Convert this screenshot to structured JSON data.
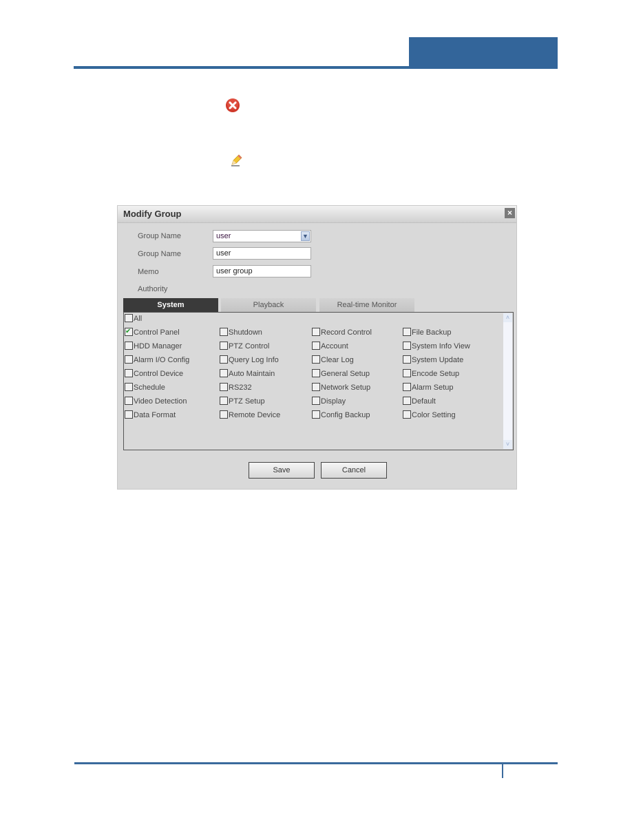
{
  "page": {
    "header_color": "#33659a",
    "icons": {
      "delete": "delete-red-x-icon",
      "edit": "pencil-edit-icon"
    }
  },
  "dialog": {
    "title": "Modify Group",
    "close_label": "×",
    "fields": {
      "group_name_select_label": "Group Name",
      "group_name_select_value": "user",
      "group_name_label": "Group Name",
      "group_name_value": "user",
      "memo_label": "Memo",
      "memo_value": "user group",
      "authority_label": "Authority"
    },
    "tabs": [
      {
        "label": "System",
        "active": true
      },
      {
        "label": "Playback",
        "active": false
      },
      {
        "label": "Real-time Monitor",
        "active": false
      }
    ],
    "all_label": "All",
    "permissions": [
      {
        "label": "Control Panel",
        "checked": true
      },
      {
        "label": "Shutdown",
        "checked": false
      },
      {
        "label": "Record Control",
        "checked": false
      },
      {
        "label": "File Backup",
        "checked": false
      },
      {
        "label": "HDD Manager",
        "checked": false
      },
      {
        "label": "PTZ Control",
        "checked": false
      },
      {
        "label": "Account",
        "checked": false
      },
      {
        "label": "System Info View",
        "checked": false
      },
      {
        "label": "Alarm I/O Config",
        "checked": false
      },
      {
        "label": "Query Log Info",
        "checked": false
      },
      {
        "label": "Clear Log",
        "checked": false
      },
      {
        "label": "System Update",
        "checked": false
      },
      {
        "label": "Control Device",
        "checked": false
      },
      {
        "label": "Auto Maintain",
        "checked": false
      },
      {
        "label": "General Setup",
        "checked": false
      },
      {
        "label": "Encode Setup",
        "checked": false
      },
      {
        "label": "Schedule",
        "checked": false
      },
      {
        "label": "RS232",
        "checked": false
      },
      {
        "label": "Network Setup",
        "checked": false
      },
      {
        "label": "Alarm Setup",
        "checked": false
      },
      {
        "label": "Video Detection",
        "checked": false
      },
      {
        "label": "PTZ Setup",
        "checked": false
      },
      {
        "label": "Display",
        "checked": false
      },
      {
        "label": "Default",
        "checked": false
      },
      {
        "label": "Data Format",
        "checked": false
      },
      {
        "label": "Remote Device",
        "checked": false
      },
      {
        "label": "Config Backup",
        "checked": false
      },
      {
        "label": "Color Setting",
        "checked": false
      }
    ],
    "buttons": {
      "save": "Save",
      "cancel": "Cancel"
    }
  }
}
